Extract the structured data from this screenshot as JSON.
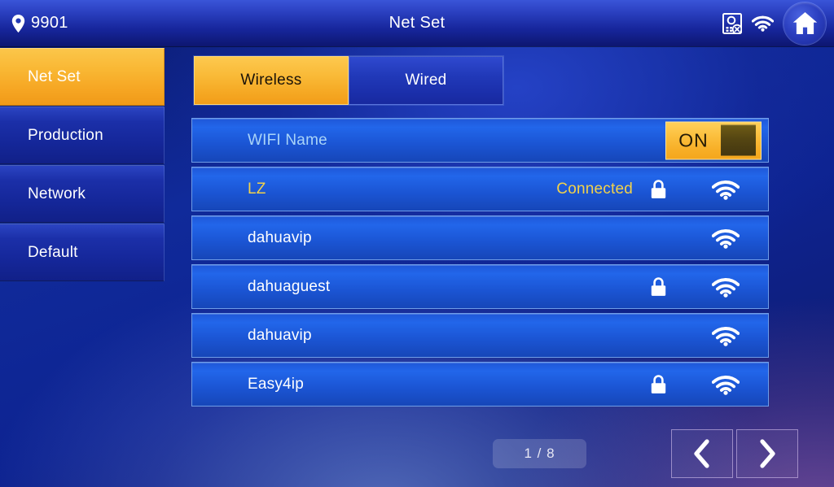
{
  "header": {
    "room_number": "9901",
    "title": "Net Set",
    "location_icon": "location-pin-icon",
    "device_status_icon": "door-station-disconnected-icon",
    "wifi_icon": "wifi-icon",
    "home_icon": "home-icon"
  },
  "sidebar": {
    "items": [
      {
        "label": "Net Set",
        "active": true
      },
      {
        "label": "Production",
        "active": false
      },
      {
        "label": "Network",
        "active": false
      },
      {
        "label": "Default",
        "active": false
      }
    ]
  },
  "tabs": [
    {
      "label": "Wireless",
      "active": true
    },
    {
      "label": "Wired",
      "active": false
    }
  ],
  "wifi_panel": {
    "header_row": {
      "label": "WIFI Name",
      "toggle_state": "ON"
    },
    "networks": [
      {
        "ssid": "LZ",
        "status": "Connected",
        "secured": true,
        "signal_icon": "wifi-icon"
      },
      {
        "ssid": "dahuavip",
        "status": "",
        "secured": false,
        "signal_icon": "wifi-icon"
      },
      {
        "ssid": "dahuaguest",
        "status": "",
        "secured": true,
        "signal_icon": "wifi-icon"
      },
      {
        "ssid": "dahuavip",
        "status": "",
        "secured": false,
        "signal_icon": "wifi-icon"
      },
      {
        "ssid": "Easy4ip",
        "status": "",
        "secured": true,
        "signal_icon": "wifi-icon"
      }
    ]
  },
  "footer": {
    "page_indicator": "1 / 8",
    "prev_icon": "chevron-left-icon",
    "next_icon": "chevron-right-icon"
  },
  "colors": {
    "accent_orange": "#f9b733",
    "connected_yellow": "#f2d24a",
    "row_blue": "#2266ea",
    "header_blue": "#17269c"
  }
}
